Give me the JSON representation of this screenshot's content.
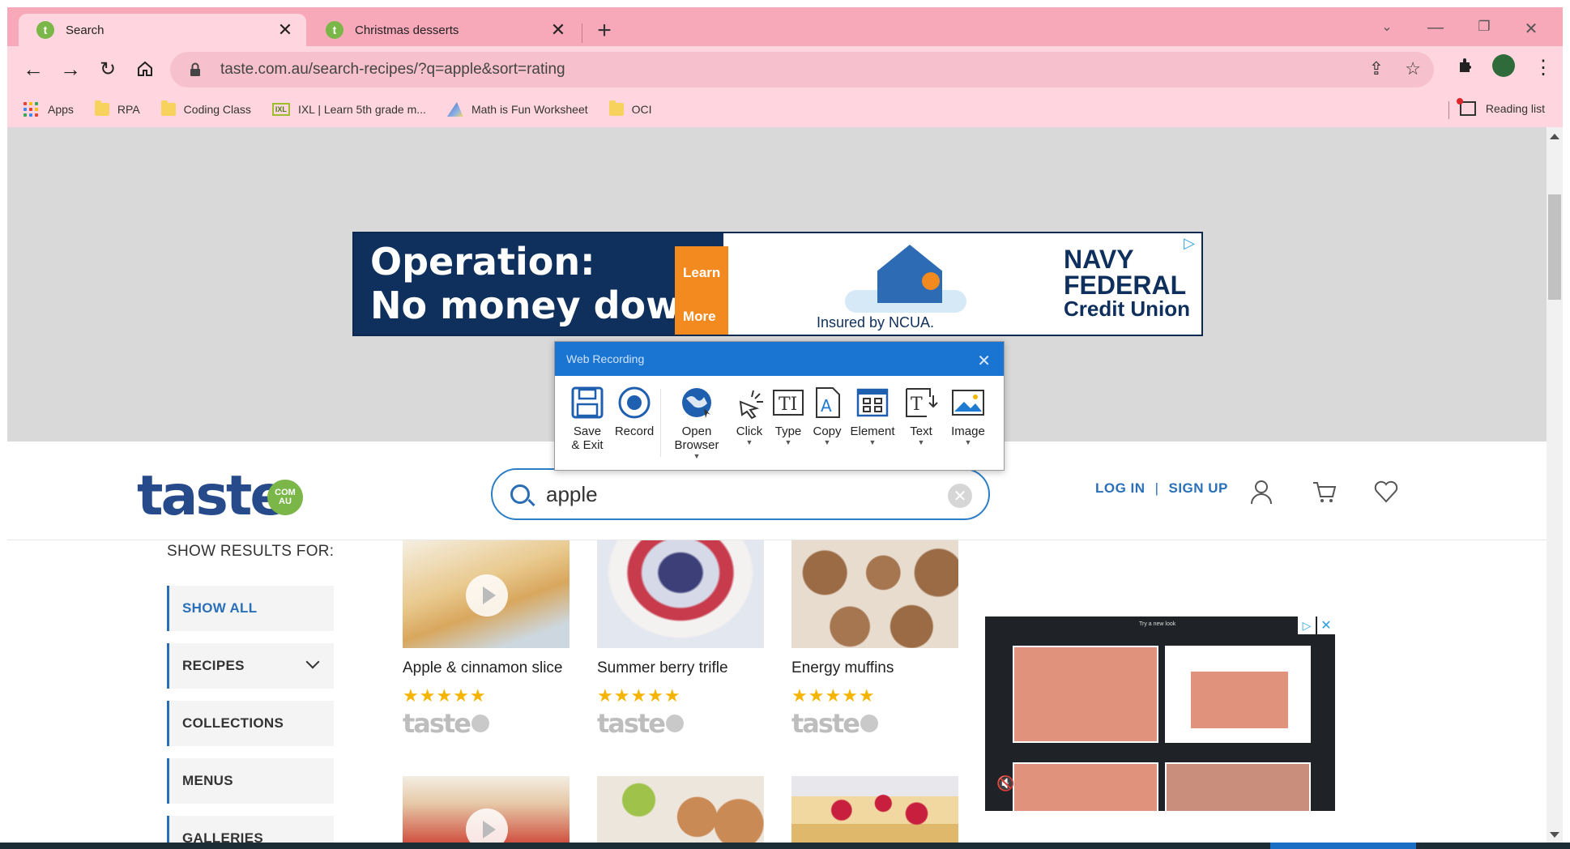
{
  "browser": {
    "tabs": [
      {
        "label": "Search",
        "active": true
      },
      {
        "label": "Christmas desserts",
        "active": false
      }
    ],
    "new_tab_icon": "plus-icon",
    "url": "taste.com.au/search-recipes/?q=apple&sort=rating",
    "bookmarks": [
      {
        "label": "Apps",
        "icon": "apps-grid-icon"
      },
      {
        "label": "RPA",
        "icon": "folder-icon"
      },
      {
        "label": "Coding Class",
        "icon": "folder-icon"
      },
      {
        "label": "IXL | Learn 5th grade m...",
        "icon": "ixl-icon"
      },
      {
        "label": "Math is Fun Worksheet",
        "icon": "math-is-fun-icon"
      },
      {
        "label": "OCI",
        "icon": "folder-icon"
      }
    ],
    "reading_list": "Reading list",
    "theme_color": "#f8a9b9"
  },
  "top_ad": {
    "headline_1": "Operation:",
    "headline_2": "No money down.",
    "cta": "Learn More",
    "insured": "Insured by NCUA.",
    "brand_1": "NAVY",
    "brand_2": "FEDERAL",
    "brand_3": "Credit Union"
  },
  "recorder": {
    "title": "Web Recording",
    "tools": [
      {
        "label": "Save & Exit",
        "icon": "save-icon"
      },
      {
        "label": "Record",
        "icon": "record-icon"
      },
      {
        "label": "Open Browser",
        "icon": "globe-icon",
        "dropdown": true
      },
      {
        "label": "Click",
        "icon": "cursor-click-icon",
        "dropdown": true
      },
      {
        "label": "Type",
        "icon": "type-icon",
        "dropdown": true
      },
      {
        "label": "Copy",
        "icon": "copy-icon",
        "dropdown": true
      },
      {
        "label": "Element",
        "icon": "element-icon",
        "dropdown": true
      },
      {
        "label": "Text",
        "icon": "text-icon",
        "dropdown": true
      },
      {
        "label": "Image",
        "icon": "image-icon",
        "dropdown": true
      }
    ],
    "accent": "#1a74d2"
  },
  "site": {
    "logo": "taste",
    "logo_badge": "COM AU",
    "search_value": "apple",
    "login": "LOG IN",
    "signup": "SIGN UP",
    "brand_color": "#274a8a"
  },
  "sidebar": {
    "heading": "SHOW RESULTS FOR:",
    "items": [
      {
        "label": "SHOW ALL"
      },
      {
        "label": "RECIPES"
      },
      {
        "label": "COLLECTIONS"
      },
      {
        "label": "MENUS"
      },
      {
        "label": "GALLERIES"
      }
    ]
  },
  "recipes": [
    {
      "title": "Apple & cinnamon slice",
      "rating": 5,
      "brand": "taste"
    },
    {
      "title": "Summer berry trifle",
      "rating": 5,
      "brand": "taste"
    },
    {
      "title": "Energy muffins",
      "rating": 5,
      "brand": "taste"
    }
  ],
  "stars": "★★★★★",
  "side_ad": {
    "caption": "Try a new look"
  }
}
